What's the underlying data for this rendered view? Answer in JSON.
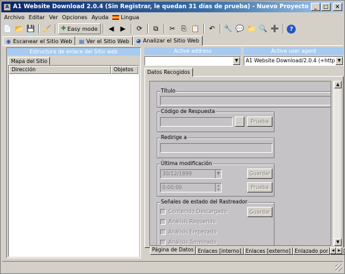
{
  "title": "A1 Website Download 2.0.4 (Sin Registrar, le quedan 31 días de prueba) - Nuevo Proyecto",
  "menu": [
    "Archivo",
    "Editar",
    "Ver",
    "Opciones",
    "Ayuda",
    "Lingua"
  ],
  "toolbar": {
    "easy_mode": "Easy mode"
  },
  "main_tabs": [
    "Escanear el Sitio Web",
    "Ver el Sitio Web",
    "Analizar el Sitio Web"
  ],
  "left": {
    "panel_title": "Estructura de enlace del Sitio web",
    "subtab": "Mapa del Sitio",
    "columns": [
      "Dirección",
      "Objetos"
    ]
  },
  "right": {
    "active_address_label": "Active address",
    "active_address_value": "",
    "active_user_agent_label": "Active user agent",
    "active_user_agent_value": "A1 Website Download/2.0.4 (+http://ww",
    "data_tab": "Datos Recogidos",
    "titulo_label": "Título",
    "codigo_label": "Código de Respuesta",
    "dots_button": "...",
    "prueba_button": "Prueba",
    "redirige_label": "Redirige a",
    "ultima_label": "Última modificación",
    "date_value": "30/12/1899",
    "time_value": "0:00:00",
    "guardar_button": "Guardar",
    "prueba_button_2": "Prueba",
    "senales_label": "Señales de estado del Rastreador",
    "guardar_button_2": "Guardar",
    "checkboxes": [
      "Contenido Descargado",
      "Análisis Requerido",
      "Análisis Empezado",
      "Análisis Terminado"
    ],
    "bottom_tabs": [
      "Página de Datos",
      "Enlaces [interno]",
      "Enlaces [externo]",
      "Enlazado por",
      "Usa [inter"
    ]
  }
}
